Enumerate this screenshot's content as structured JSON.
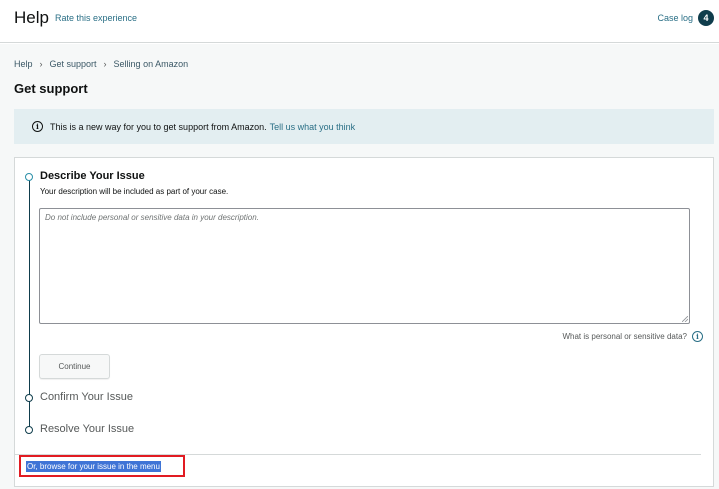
{
  "header": {
    "title": "Help",
    "rate_link": "Rate this experience",
    "case_log_label": "Case log",
    "case_log_count": "4"
  },
  "breadcrumb": [
    "Help",
    "Get support",
    "Selling on Amazon"
  ],
  "page_title": "Get support",
  "banner": {
    "icon": "info-icon",
    "text": "This is a new way for you to get support from Amazon.",
    "link": "Tell us what you think"
  },
  "steps": {
    "describe": {
      "title": "Describe Your Issue",
      "subtitle": "Your description will be included as part of your case.",
      "placeholder": "Do not include personal or sensitive data in your description.",
      "sensitive_link": "What is personal or sensitive data?",
      "continue_label": "Continue"
    },
    "confirm": {
      "title": "Confirm Your Issue"
    },
    "resolve": {
      "title": "Resolve Your Issue"
    }
  },
  "browse_link": "Or, browse for your issue in the menu",
  "colors": {
    "accent": "#0f3d4c",
    "link": "#2a6f86",
    "banner_bg": "#e3eef1",
    "highlight_border": "#e11b22",
    "selection": "#3f74d6"
  }
}
